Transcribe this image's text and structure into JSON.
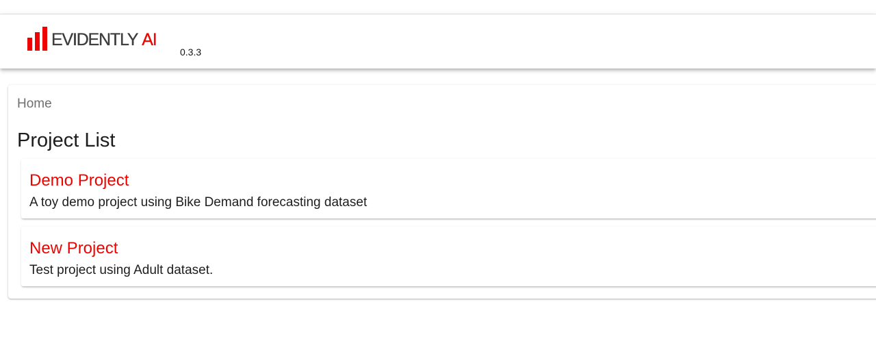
{
  "header": {
    "logo_text": "EVIDENTLY",
    "logo_accent": "AI",
    "version": "0.3.3"
  },
  "breadcrumb": {
    "home": "Home"
  },
  "page": {
    "title": "Project List"
  },
  "projects": [
    {
      "name": "Demo Project",
      "description": "A toy demo project using Bike Demand forecasting dataset"
    },
    {
      "name": "New Project",
      "description": "Test project using Adult dataset."
    }
  ],
  "colors": {
    "accent": "#ed0400",
    "text": "#1d1d1d",
    "muted": "#6f6f6f"
  }
}
